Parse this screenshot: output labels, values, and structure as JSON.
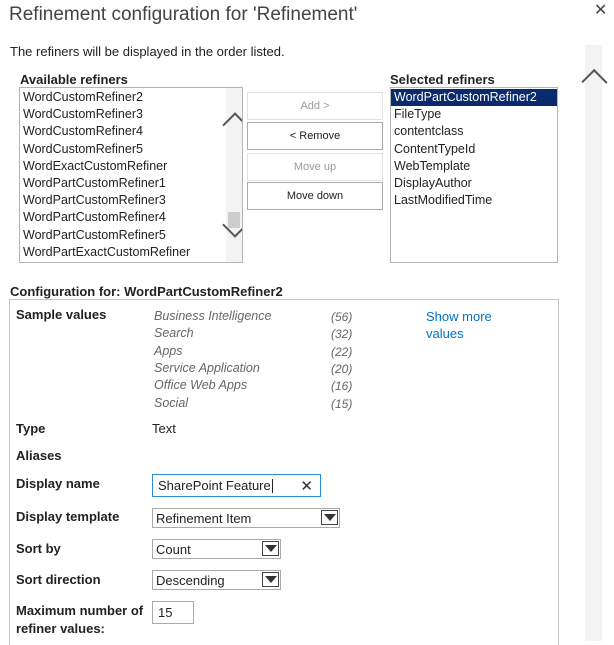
{
  "dialog": {
    "title": "Refinement configuration for 'Refinement'",
    "close_glyph": "✕",
    "intro": "The refiners will be displayed in the order listed."
  },
  "available": {
    "label": "Available refiners",
    "items": [
      "WordCustomRefiner2",
      "WordCustomRefiner3",
      "WordCustomRefiner4",
      "WordCustomRefiner5",
      "WordExactCustomRefiner",
      "WordPartCustomRefiner1",
      "WordPartCustomRefiner3",
      "WordPartCustomRefiner4",
      "WordPartCustomRefiner5",
      "WordPartExactCustomRefiner"
    ]
  },
  "selected": {
    "label": "Selected refiners",
    "items": [
      "WordPartCustomRefiner2",
      "FileType",
      "contentclass",
      "ContentTypeId",
      "WebTemplate",
      "DisplayAuthor",
      "LastModifiedTime"
    ]
  },
  "buttons": {
    "add": "Add >",
    "remove": "< Remove",
    "move_up": "Move up",
    "move_down": "Move down"
  },
  "config": {
    "header": "Configuration for: WordPartCustomRefiner2",
    "sample_values_label": "Sample values",
    "sample_values": [
      {
        "name": "Business Intelligence",
        "count": "(56)"
      },
      {
        "name": "Search",
        "count": "(32)"
      },
      {
        "name": "Apps",
        "count": "(22)"
      },
      {
        "name": "Service Application",
        "count": "(20)"
      },
      {
        "name": "Office Web Apps",
        "count": "(16)"
      },
      {
        "name": "Social",
        "count": "(15)"
      }
    ],
    "show_more_line1": "Show more",
    "show_more_line2": "values",
    "type_label": "Type",
    "type_value": "Text",
    "aliases_label": "Aliases",
    "display_name_label": "Display name",
    "display_name_value": "SharePoint Feature",
    "display_template_label": "Display template",
    "display_template_value": "Refinement Item",
    "sort_by_label": "Sort by",
    "sort_by_value": "Count",
    "sort_direction_label": "Sort direction",
    "sort_direction_value": "Descending",
    "max_values_label_line1": "Maximum number of",
    "max_values_label_line2": "refiner values:",
    "max_values_value": "15"
  }
}
